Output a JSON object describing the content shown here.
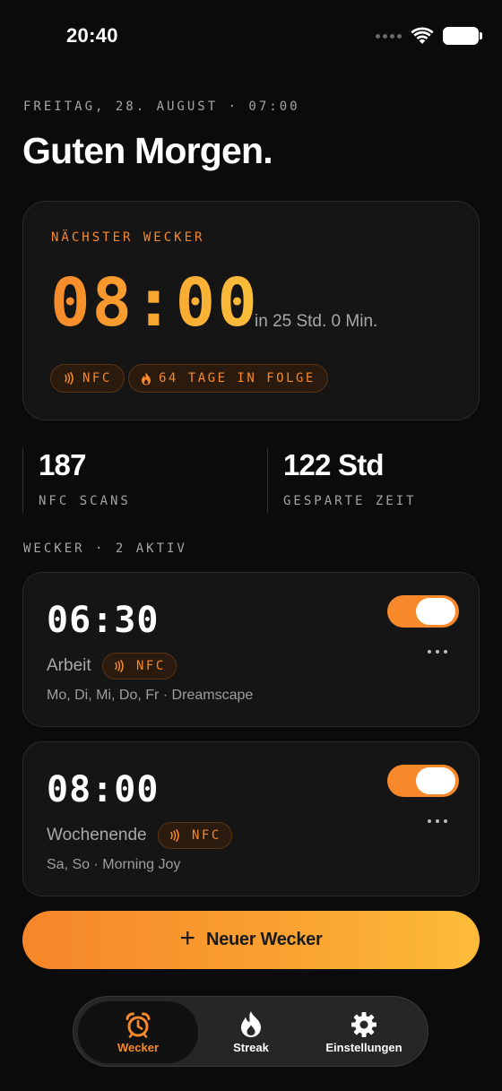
{
  "status_bar": {
    "time": "20:40",
    "icons": [
      "cellular-dots-icon",
      "wifi-icon",
      "battery-icon"
    ]
  },
  "header": {
    "date_line": "FREITAG, 28. AUGUST · 07:00",
    "greeting": "Guten Morgen."
  },
  "next_alarm": {
    "label": "NÄCHSTER WECKER",
    "time": "08:00",
    "relative": "in 25 Std. 0 Min.",
    "chips": [
      {
        "icon": "nfc-icon",
        "text": "NFC"
      },
      {
        "icon": "flame-icon",
        "text": "64 TAGE IN FOLGE"
      }
    ]
  },
  "stats": [
    {
      "value": "187",
      "label": "NFC SCANS"
    },
    {
      "value": "122 Std",
      "label": "GESPARTE ZEIT"
    }
  ],
  "section_label": "WECKER · 2 AKTIV",
  "alarms": [
    {
      "time": "06:30",
      "name": "Arbeit",
      "chip": "NFC",
      "meta": "Mo, Di, Mi, Do, Fr · Dreamscape",
      "enabled": true
    },
    {
      "time": "08:00",
      "name": "Wochenende",
      "chip": "NFC",
      "meta": "Sa, So · Morning Joy",
      "enabled": true
    }
  ],
  "new_button": {
    "label": "Neuer Wecker"
  },
  "tabs": [
    {
      "label": "Wecker",
      "icon": "alarm-clock-icon",
      "active": true
    },
    {
      "label": "Streak",
      "icon": "flame-icon",
      "active": false
    },
    {
      "label": "Einstellungen",
      "icon": "gear-icon",
      "active": false
    }
  ],
  "colors": {
    "accent": "#f7892a",
    "accent_light": "#fbbf3b",
    "background": "#0b0b0b",
    "card": "#151515"
  }
}
